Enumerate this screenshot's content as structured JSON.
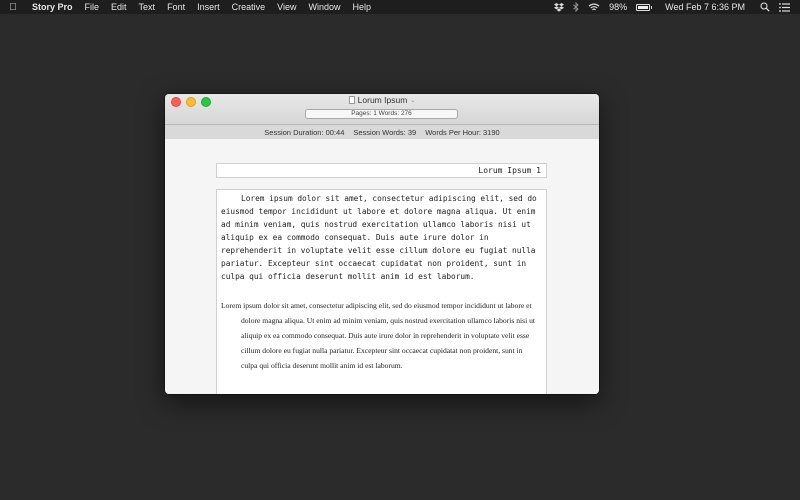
{
  "menubar": {
    "app_name": "Story Pro",
    "menus": [
      "File",
      "Edit",
      "Text",
      "Font",
      "Insert",
      "Creative",
      "View",
      "Window",
      "Help"
    ],
    "battery_percent": "98%",
    "battery_level": 0.98,
    "datetime": "Wed Feb 7  6:36 PM",
    "icons": [
      "apple-icon",
      "dropbox-icon",
      "bluetooth-icon",
      "wifi-icon",
      "battery-icon",
      "search-icon",
      "list-icon"
    ]
  },
  "window": {
    "title": "Lorum Ipsum",
    "info": "Pages: 1  Words: 276",
    "session": {
      "duration_label": "Session Duration:",
      "duration_value": "00:44",
      "words_label": "Session Words:",
      "words_value": "39",
      "wph_label": "Words Per Hour:",
      "wph_value": "3190"
    }
  },
  "document": {
    "header_text": "Lorum Ipsum 1",
    "mono_paragraph": "Lorem ipsum dolor sit amet, consectetur adipiscing elit, sed do eiusmod tempor incididunt ut labore et dolore magna aliqua. Ut enim ad minim veniam, quis nostrud exercitation ullamco laboris nisi ut aliquip ex ea commodo consequat. Duis aute irure dolor in reprehenderit in voluptate velit esse cillum dolore eu fugiat nulla pariatur. Excepteur sint occaecat cupidatat non proident, sunt in culpa qui officia deserunt mollit anim id est laborum.",
    "serif_paragraph": "Lorem ipsum dolor sit amet, consectetur adipiscing elit, sed do eiusmod tempor incididunt ut labore et dolore magna aliqua. Ut enim ad minim veniam, quis nostrud exercitation ullamco laboris nisi ut aliquip ex ea commodo consequat. Duis aute irure dolor in reprehenderit in voluptate velit esse cillum dolore eu fugiat nulla pariatur. Excepteur sint occaecat cupidatat non proident, sunt in culpa qui officia deserunt mollit anim id est laborum."
  },
  "colors": {
    "desktop": "#2b2b2b",
    "menubar": "#1e1e1e",
    "close": "#fc5f57",
    "minimize": "#fdbc2e",
    "maximize": "#28c840"
  }
}
